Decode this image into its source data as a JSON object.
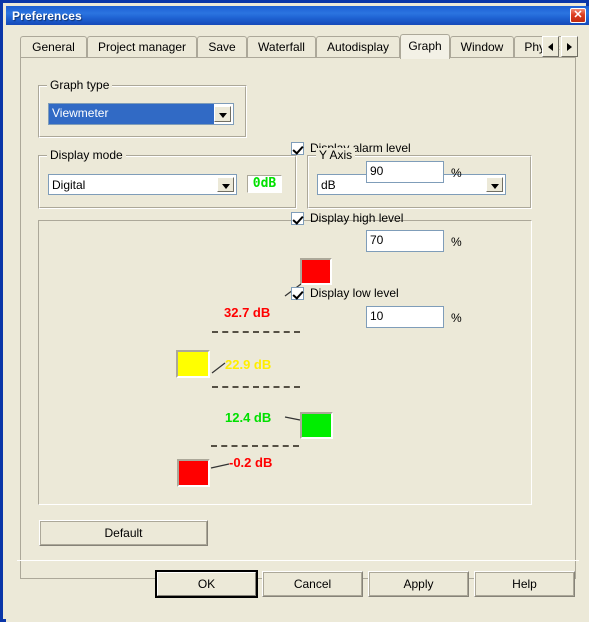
{
  "window": {
    "title": "Preferences",
    "close_label": "✕"
  },
  "tabs": {
    "items": [
      {
        "label": "General",
        "active": false
      },
      {
        "label": "Project manager",
        "active": false
      },
      {
        "label": "Save",
        "active": false
      },
      {
        "label": "Waterfall",
        "active": false
      },
      {
        "label": "Autodisplay",
        "active": false
      },
      {
        "label": "Graph",
        "active": true
      },
      {
        "label": "Window",
        "active": false
      },
      {
        "label": "Physic",
        "active": false
      }
    ],
    "scroll_left": "◄",
    "scroll_right": "►"
  },
  "graph_type": {
    "title": "Graph type",
    "value": "Viewmeter"
  },
  "display_mode": {
    "title": "Display mode",
    "value": "Digital",
    "lcd_value": "0dB"
  },
  "y_axis": {
    "title": "Y Axis",
    "value": "dB"
  },
  "preview": {
    "markers": [
      {
        "name": "alarm-top",
        "value": "32.7 dB",
        "color": "#ff0000"
      },
      {
        "name": "high",
        "value": "22.9 dB",
        "color": "#ffee00"
      },
      {
        "name": "low",
        "value": "12.4 dB",
        "color": "#00e000"
      },
      {
        "name": "bottom",
        "value": "-0.2 dB",
        "color": "#ff0000"
      }
    ],
    "swatches": [
      {
        "name": "alarm-swatch",
        "color": "#ff0000"
      },
      {
        "name": "high-swatch",
        "color": "#ffff00"
      },
      {
        "name": "normal-swatch",
        "color": "#00ee00"
      },
      {
        "name": "low-swatch",
        "color": "#ff0000"
      }
    ]
  },
  "levels": [
    {
      "id": "alarm",
      "label": "Display alarm level",
      "checked": true,
      "value": "90",
      "unit": "%"
    },
    {
      "id": "high",
      "label": "Display high level",
      "checked": true,
      "value": "70",
      "unit": "%"
    },
    {
      "id": "low",
      "label": "Display low level",
      "checked": true,
      "value": "10",
      "unit": "%"
    }
  ],
  "buttons": {
    "default": "Default",
    "ok": "OK",
    "cancel": "Cancel",
    "apply": "Apply",
    "help": "Help"
  },
  "colors": {
    "titlebar": "#1f63d3",
    "face": "#ece9d8",
    "border": "#0a36a8",
    "highlight": "#316ac5",
    "lcd_green": "#00e000"
  }
}
